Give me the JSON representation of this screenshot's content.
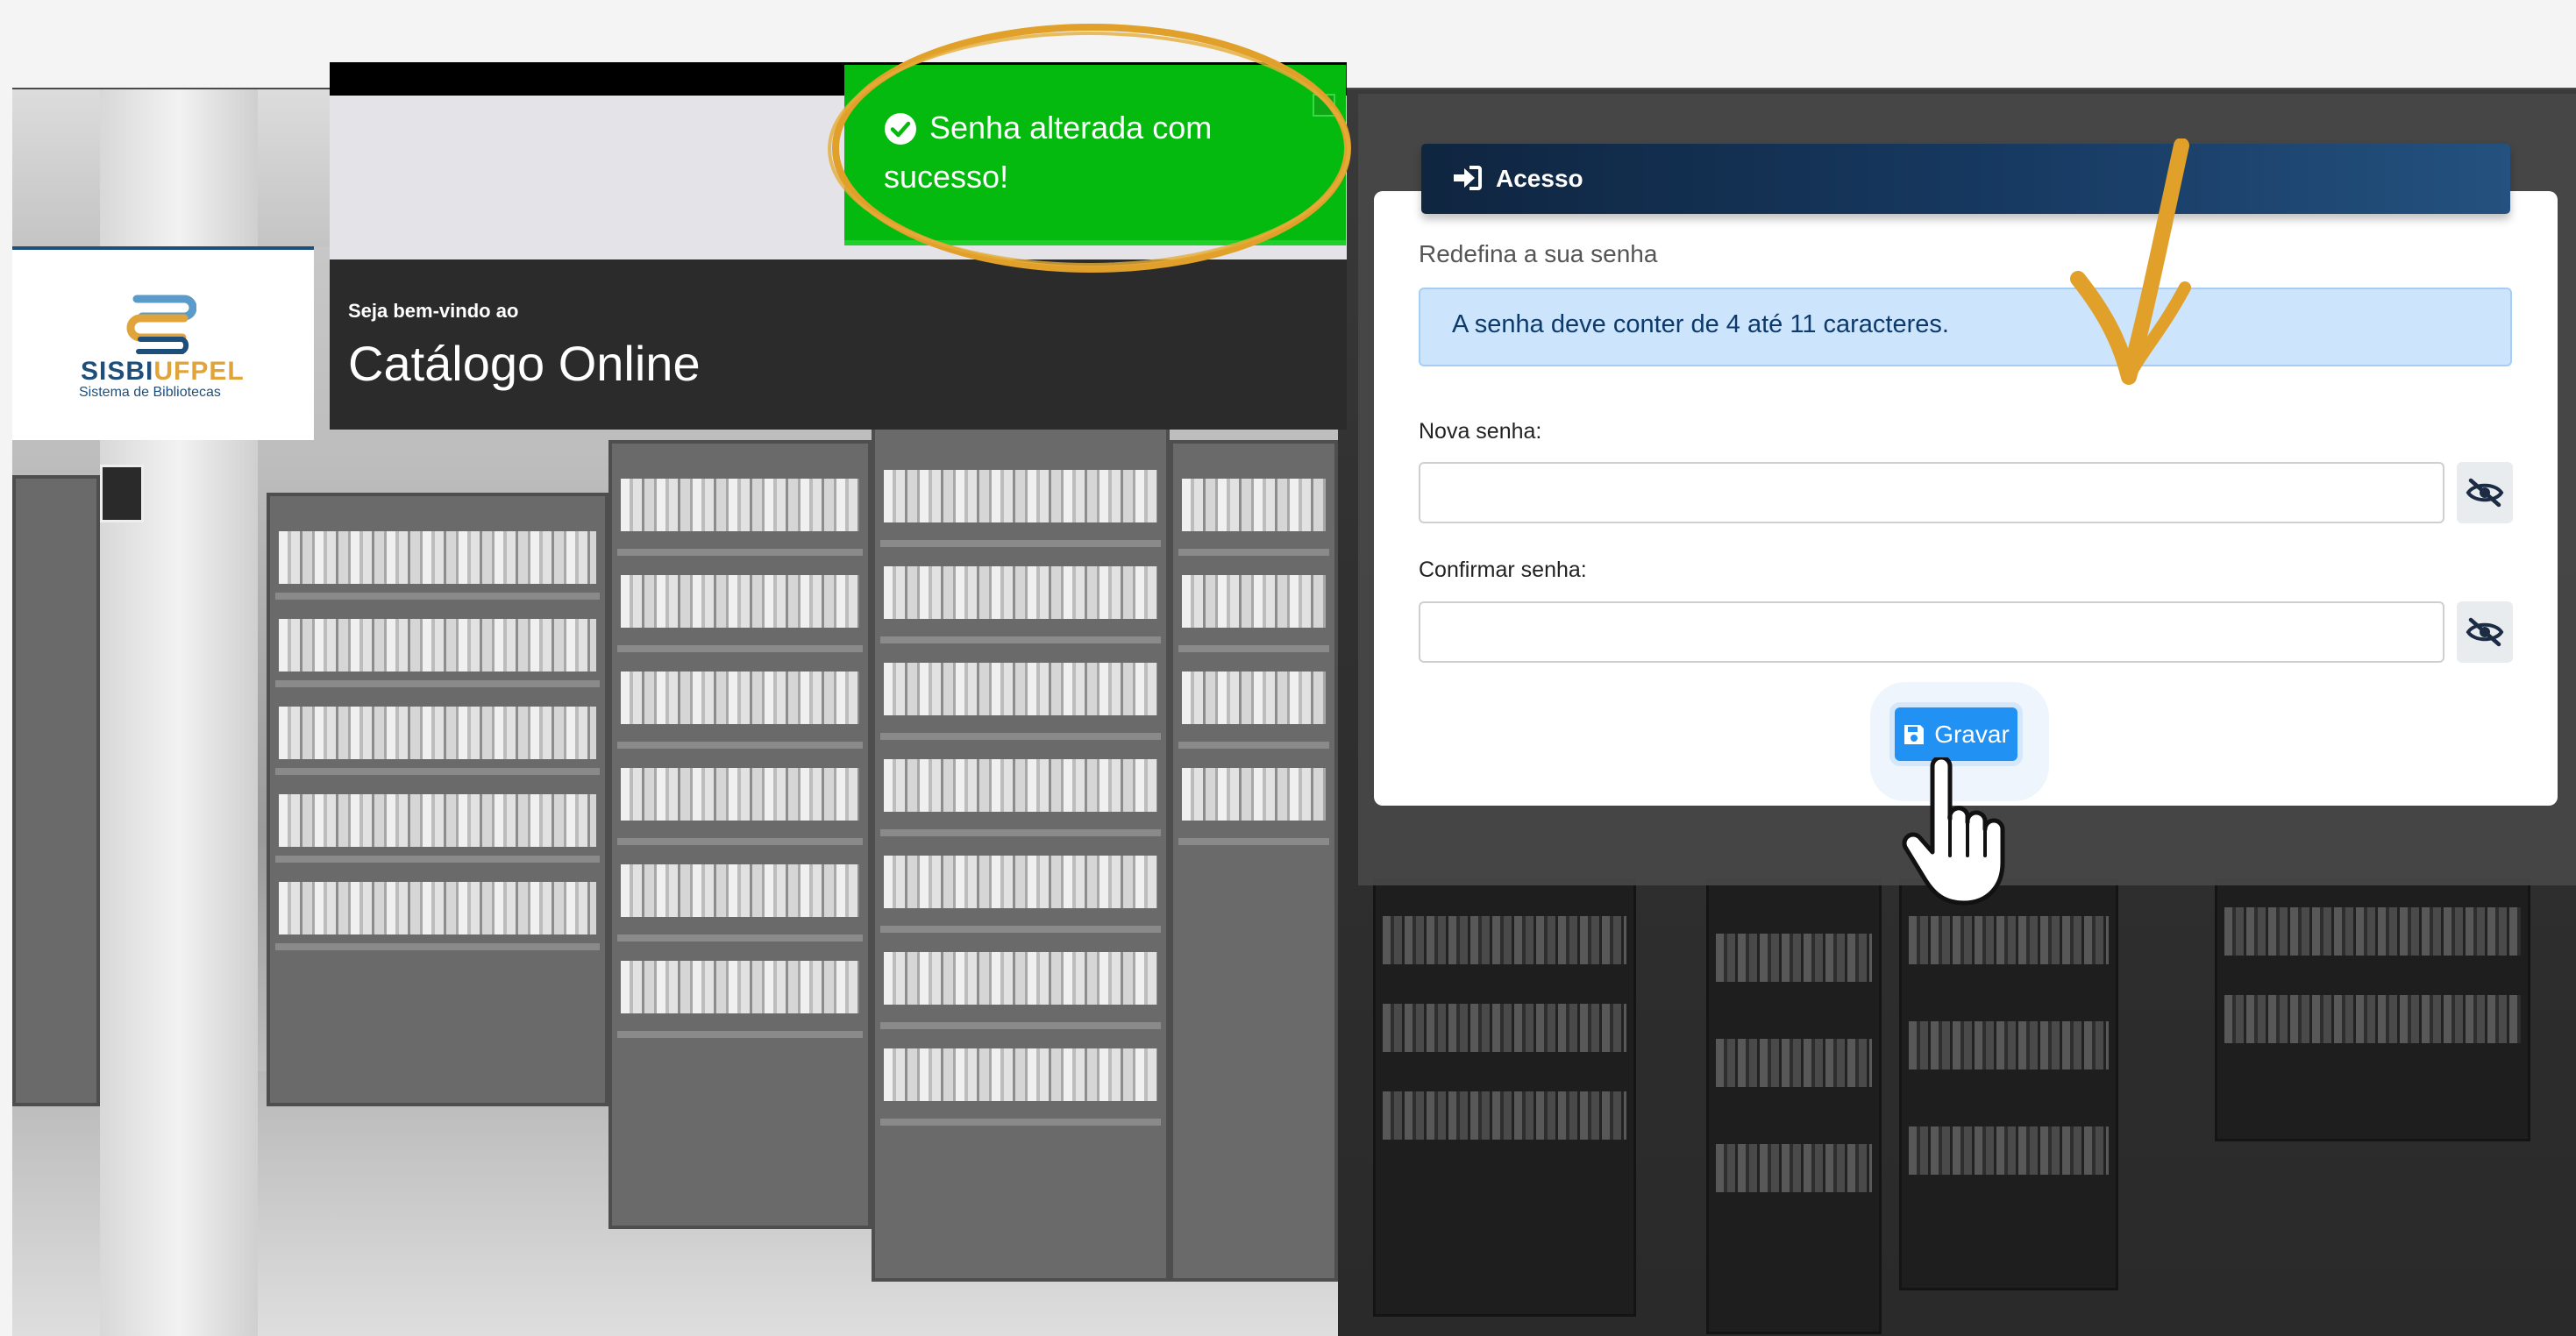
{
  "toast": {
    "message": "Senha alterada com sucesso!",
    "icon": "check-circle-icon",
    "background_color": "#05ba0f"
  },
  "header": {
    "welcome": "Seja bem-vindo ao",
    "title": "Catálogo Online"
  },
  "logo": {
    "name_part1": "SISBI",
    "name_part2": "UFPEL",
    "subtitle": "Sistema de Bibliotecas",
    "colors": {
      "primary": "#1e4f7a",
      "accent": "#e0a43a"
    }
  },
  "login_panel": {
    "header_label": "Acesso",
    "header_icon": "sign-in-icon",
    "subtitle": "Redefina a sua senha",
    "alert": "A senha deve conter de 4 até 11 caracteres.",
    "fields": [
      {
        "label": "Nova senha:",
        "value": "",
        "toggle_icon": "eye-slash-icon"
      },
      {
        "label": "Confirmar senha:",
        "value": "",
        "toggle_icon": "eye-slash-icon"
      }
    ],
    "save_button": {
      "label": "Gravar",
      "icon": "floppy-disk-icon",
      "color": "#2291f4"
    }
  },
  "annotations": {
    "highlight_color": "#e0a02a",
    "arrow_icon": "checkmark-arrow-icon",
    "pointer_icon": "hand-pointer-icon"
  }
}
